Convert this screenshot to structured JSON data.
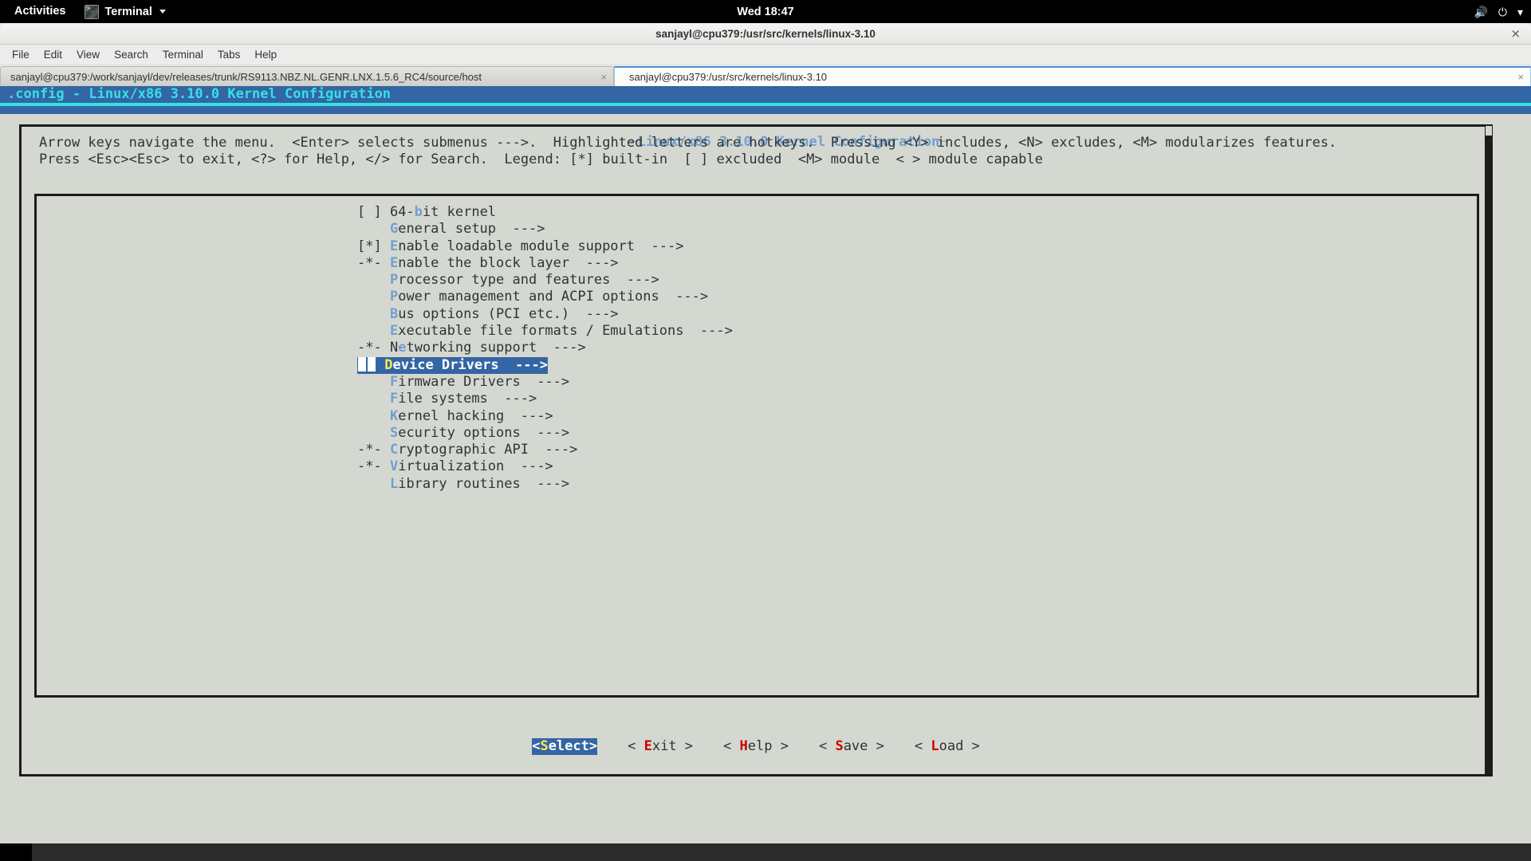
{
  "topbar": {
    "activities": "Activities",
    "app_name": "Terminal",
    "clock": "Wed 18:47",
    "volume_icon": "volume-icon",
    "power_icon": "power-icon",
    "chevron_icon": "chevron-down-icon"
  },
  "window": {
    "title": "sanjayl@cpu379:/usr/src/kernels/linux-3.10",
    "close_glyph": "×",
    "menus": [
      "File",
      "Edit",
      "View",
      "Search",
      "Terminal",
      "Tabs",
      "Help"
    ]
  },
  "tabs": [
    {
      "label": "sanjayl@cpu379:/work/sanjayl/dev/releases/trunk/RS9113.NBZ.NL.GENR.LNX.1.5.6_RC4/source/host",
      "active": false,
      "close_glyph": "×"
    },
    {
      "label": "sanjayl@cpu379:/usr/src/kernels/linux-3.10",
      "active": true,
      "close_glyph": "×"
    }
  ],
  "terminal": {
    "config_header": ".config - Linux/x86 3.10.0 Kernel Configuration",
    "dialog_title": "Linux/x86 3.10.0 Kernel Configuration",
    "help_line_1": "Arrow keys navigate the menu.  <Enter> selects submenus --->.  Highlighted letters are hotkeys.  Pressing <Y> includes, <N> excludes, <M> modularizes features.",
    "help_line_2": "Press <Esc><Esc> to exit, <?> for Help, </> for Search.  Legend: [*] built-in  [ ] excluded  <M> module  < > module capable",
    "menu_items": [
      {
        "flag": "[ ]",
        "pre": "64-",
        "hot": "b",
        "post": "it kernel",
        "arrow": "",
        "selected": false
      },
      {
        "flag": "   ",
        "pre": "",
        "hot": "G",
        "post": "eneral setup",
        "arrow": "  --->",
        "selected": false
      },
      {
        "flag": "[*]",
        "pre": "",
        "hot": "E",
        "post": "nable loadable module support",
        "arrow": "  --->",
        "selected": false
      },
      {
        "flag": "-*-",
        "pre": "",
        "hot": "E",
        "post": "nable the block layer",
        "arrow": "  --->",
        "selected": false
      },
      {
        "flag": "   ",
        "pre": "",
        "hot": "P",
        "post": "rocessor type and features",
        "arrow": "  --->",
        "selected": false
      },
      {
        "flag": "   ",
        "pre": "",
        "hot": "P",
        "post": "ower management and ACPI options",
        "arrow": "  --->",
        "selected": false
      },
      {
        "flag": "   ",
        "pre": "",
        "hot": "B",
        "post": "us options (PCI etc.)",
        "arrow": "  --->",
        "selected": false
      },
      {
        "flag": "   ",
        "pre": "",
        "hot": "E",
        "post": "xecutable file formats / Emulations",
        "arrow": "  --->",
        "selected": false
      },
      {
        "flag": "-*-",
        "pre": "N",
        "hot": "e",
        "post": "tworking support",
        "arrow": "  --->",
        "selected": false
      },
      {
        "flag": "   ",
        "pre": "",
        "hot": "D",
        "post": "evice Drivers",
        "arrow": "  --->",
        "selected": true
      },
      {
        "flag": "   ",
        "pre": "",
        "hot": "F",
        "post": "irmware Drivers",
        "arrow": "  --->",
        "selected": false
      },
      {
        "flag": "   ",
        "pre": "",
        "hot": "F",
        "post": "ile systems",
        "arrow": "  --->",
        "selected": false
      },
      {
        "flag": "   ",
        "pre": "",
        "hot": "K",
        "post": "ernel hacking",
        "arrow": "  --->",
        "selected": false
      },
      {
        "flag": "   ",
        "pre": "",
        "hot": "S",
        "post": "ecurity options",
        "arrow": "  --->",
        "selected": false
      },
      {
        "flag": "-*-",
        "pre": "",
        "hot": "C",
        "post": "ryptographic API",
        "arrow": "  --->",
        "selected": false
      },
      {
        "flag": "-*-",
        "pre": "",
        "hot": "V",
        "post": "irtualization",
        "arrow": "  --->",
        "selected": false
      },
      {
        "flag": "   ",
        "pre": "",
        "hot": "L",
        "post": "ibrary routines",
        "arrow": "  --->",
        "selected": false
      }
    ],
    "buttons": [
      {
        "pre": "<",
        "hot": "S",
        "post": "elect>",
        "selected": true
      },
      {
        "pre": "< ",
        "hot": "E",
        "post": "xit >",
        "selected": false
      },
      {
        "pre": "< ",
        "hot": "H",
        "post": "elp >",
        "selected": false
      },
      {
        "pre": "< ",
        "hot": "S",
        "post": "ave >",
        "selected": false
      },
      {
        "pre": "< ",
        "hot": "L",
        "post": "oad >",
        "selected": false
      }
    ]
  },
  "colors": {
    "terminal_bg": "#d5d8d0",
    "header_blue": "#3465a4",
    "header_cyan": "#34e2e2",
    "hotkey_blue": "#729fcf",
    "hotkey_yellow": "#fce94f",
    "button_hotkey_red": "#cc0000",
    "text": "#2e3436"
  }
}
